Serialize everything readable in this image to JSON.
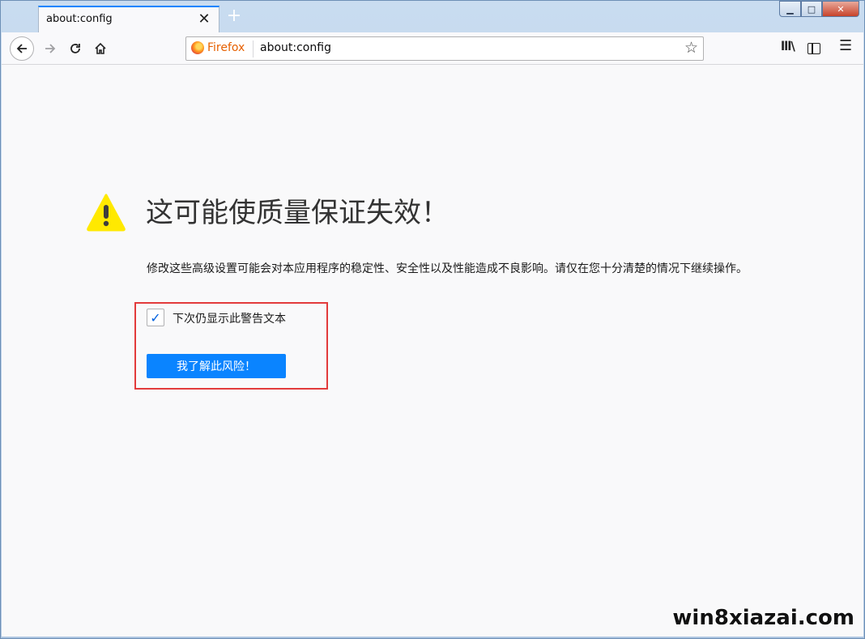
{
  "tab": {
    "title": "about:config",
    "close_glyph": "✕",
    "new_tab_glyph": "+"
  },
  "window_controls": {
    "minimize": "▁",
    "maximize": "□",
    "close": "✕"
  },
  "toolbar": {
    "back_icon": "back-arrow-icon",
    "forward_icon": "forward-arrow-icon",
    "reload_icon": "reload-icon",
    "home_icon": "home-icon"
  },
  "urlbar": {
    "identity_label": "Firefox",
    "url": "about:config",
    "bookmark_icon": "star-icon"
  },
  "content": {
    "title": "这可能使质量保证失效！",
    "description": "修改这些高级设置可能会对本应用程序的稳定性、安全性以及性能造成不良影响。请仅在您十分清楚的情况下继续操作。",
    "checkbox": {
      "label": "下次仍显示此警告文本",
      "checked": true
    },
    "accept_button": "我了解此风险！"
  },
  "watermark": "win8xiazai.com",
  "colors": {
    "accent": "#0a84ff",
    "warning": "#ffe900",
    "highlight_box": "#e23b3b"
  }
}
